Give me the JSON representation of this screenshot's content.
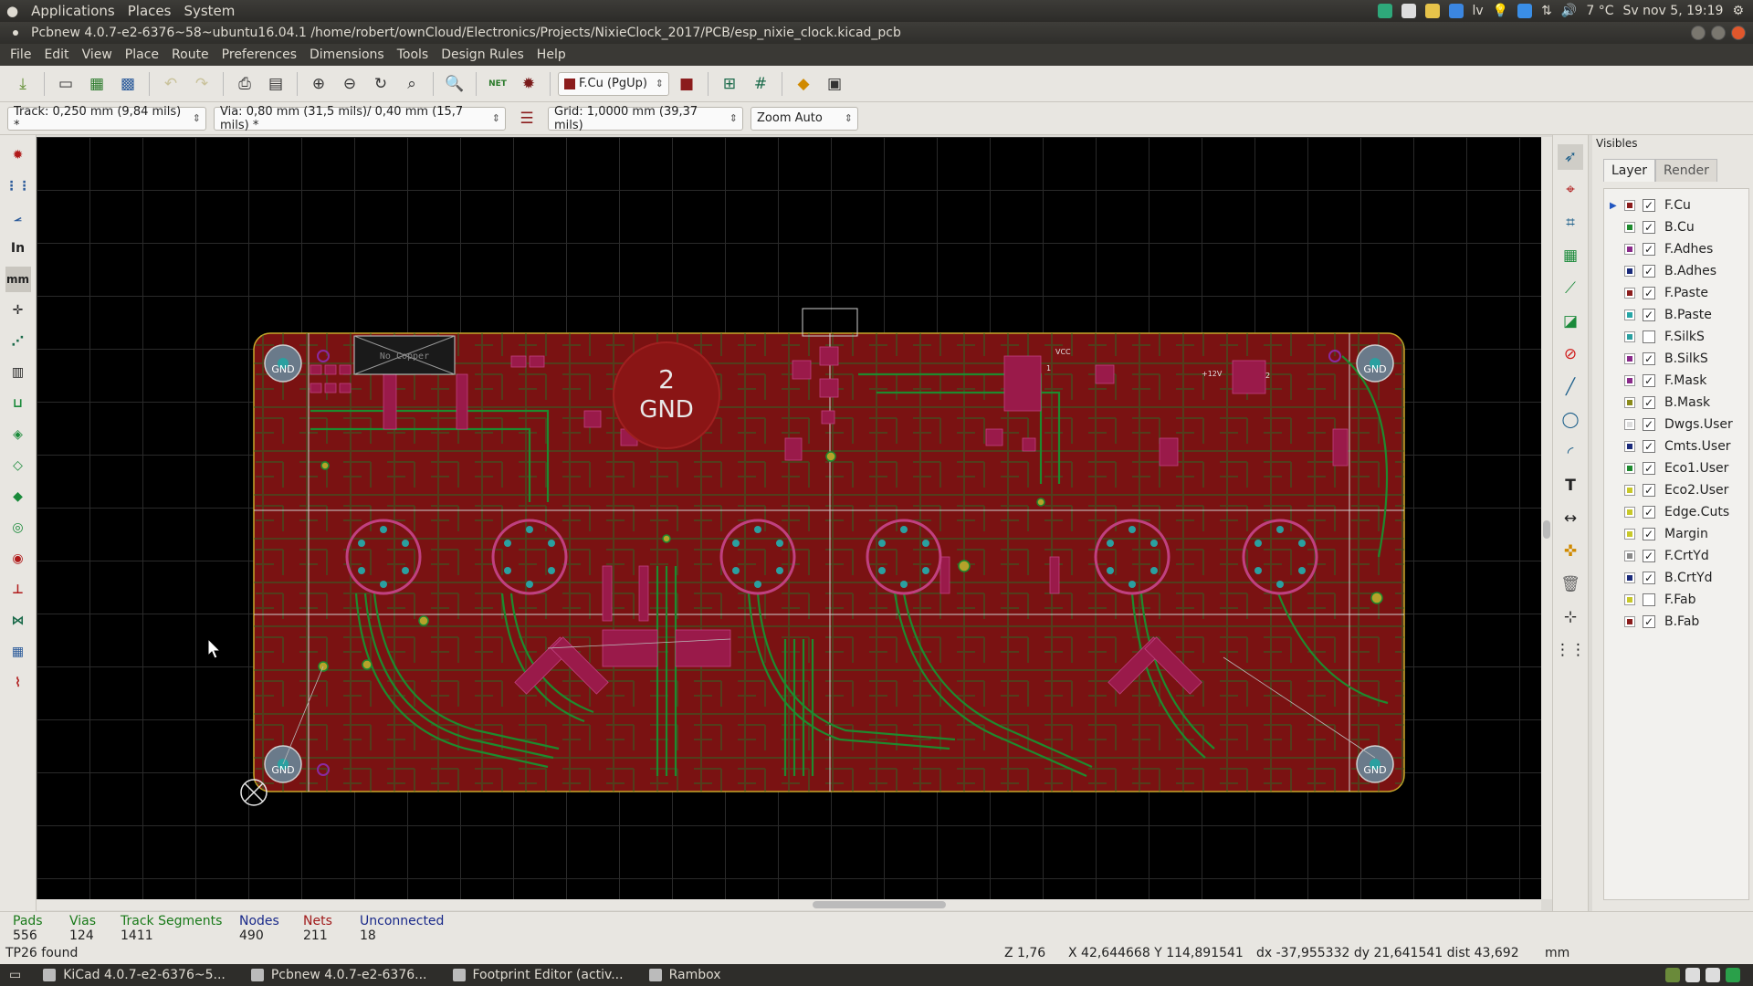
{
  "top_panel": {
    "menus": [
      "Applications",
      "Places",
      "System"
    ],
    "tray": {
      "keyboard": "lv",
      "weather": "7 °C",
      "clock": "Sv nov 5, 19:19"
    }
  },
  "window": {
    "title": "Pcbnew 4.0.7-e2-6376~58~ubuntu16.04.1 /home/robert/ownCloud/Electronics/Projects/NixieClock_2017/PCB/esp_nixie_clock.kicad_pcb"
  },
  "menu_bar": [
    "File",
    "Edit",
    "View",
    "Place",
    "Route",
    "Preferences",
    "Dimensions",
    "Tools",
    "Design Rules",
    "Help"
  ],
  "toolbar": {
    "layer_select": "F.Cu (PgUp)",
    "net_label": "NET"
  },
  "options": {
    "track": "Track: 0,250 mm (9,84 mils) *",
    "via": "Via: 0,80 mm (31,5 mils)/ 0,40 mm (15,7 mils) *",
    "grid": "Grid: 1,0000 mm (39,37 mils)",
    "zoom": "Zoom Auto"
  },
  "left_toolbar": {
    "inch_label": "In",
    "mm_label": "mm"
  },
  "board": {
    "keepout_label": "No Copper",
    "gnd_zone_number": "2",
    "gnd_zone_net": "GND",
    "mount_hole_label": "GND",
    "pad_labels": [
      "VCC",
      "+12V",
      "2",
      "1"
    ]
  },
  "visibles": {
    "title": "Visibles",
    "tabs": [
      "Layer",
      "Render"
    ],
    "layers": [
      {
        "name": "F.Cu",
        "color": "#8b1c1c",
        "checked": true,
        "active": true
      },
      {
        "name": "B.Cu",
        "color": "#1e8a2e",
        "checked": true
      },
      {
        "name": "F.Adhes",
        "color": "#8a2a8a",
        "checked": true
      },
      {
        "name": "B.Adhes",
        "color": "#1a2a7a",
        "checked": true
      },
      {
        "name": "F.Paste",
        "color": "#8b1c1c",
        "checked": true
      },
      {
        "name": "B.Paste",
        "color": "#27a6a6",
        "checked": true
      },
      {
        "name": "F.SilkS",
        "color": "#2aa0a0",
        "checked": false
      },
      {
        "name": "B.SilkS",
        "color": "#8a2a8a",
        "checked": true
      },
      {
        "name": "F.Mask",
        "color": "#8a2a8a",
        "checked": true
      },
      {
        "name": "B.Mask",
        "color": "#8a8a1a",
        "checked": true
      },
      {
        "name": "Dwgs.User",
        "color": "#dddddd",
        "checked": true
      },
      {
        "name": "Cmts.User",
        "color": "#1a2a7a",
        "checked": true
      },
      {
        "name": "Eco1.User",
        "color": "#1e8a2e",
        "checked": true
      },
      {
        "name": "Eco2.User",
        "color": "#c8c82a",
        "checked": true
      },
      {
        "name": "Edge.Cuts",
        "color": "#c8c82a",
        "checked": true
      },
      {
        "name": "Margin",
        "color": "#c8c82a",
        "checked": true
      },
      {
        "name": "F.CrtYd",
        "color": "#888888",
        "checked": true
      },
      {
        "name": "B.CrtYd",
        "color": "#1a2a7a",
        "checked": true
      },
      {
        "name": "F.Fab",
        "color": "#c8c82a",
        "checked": false
      },
      {
        "name": "B.Fab",
        "color": "#8b1c1c",
        "checked": true
      }
    ]
  },
  "stats": {
    "pads": {
      "label": "Pads",
      "value": "556",
      "color": "#1a7a1a"
    },
    "vias": {
      "label": "Vias",
      "value": "124",
      "color": "#1a7a1a"
    },
    "track_segments": {
      "label": "Track Segments",
      "value": "1411",
      "color": "#1a7a1a"
    },
    "nodes": {
      "label": "Nodes",
      "value": "490",
      "color": "#1a2a8a"
    },
    "nets": {
      "label": "Nets",
      "value": "211",
      "color": "#a01a1a"
    },
    "unconnected": {
      "label": "Unconnected",
      "value": "18",
      "color": "#1a2a8a"
    }
  },
  "status": {
    "message": "TP26 found",
    "zoom": "Z 1,76",
    "coords": "X 42,644668  Y 114,891541",
    "delta": "dx -37,955332  dy 21,641541  dist 43,692",
    "units": "mm"
  },
  "taskbar": [
    "KiCad 4.0.7-e2-6376~5...",
    "Pcbnew 4.0.7-e2-6376...",
    "Footprint Editor (activ...",
    "Rambox"
  ]
}
